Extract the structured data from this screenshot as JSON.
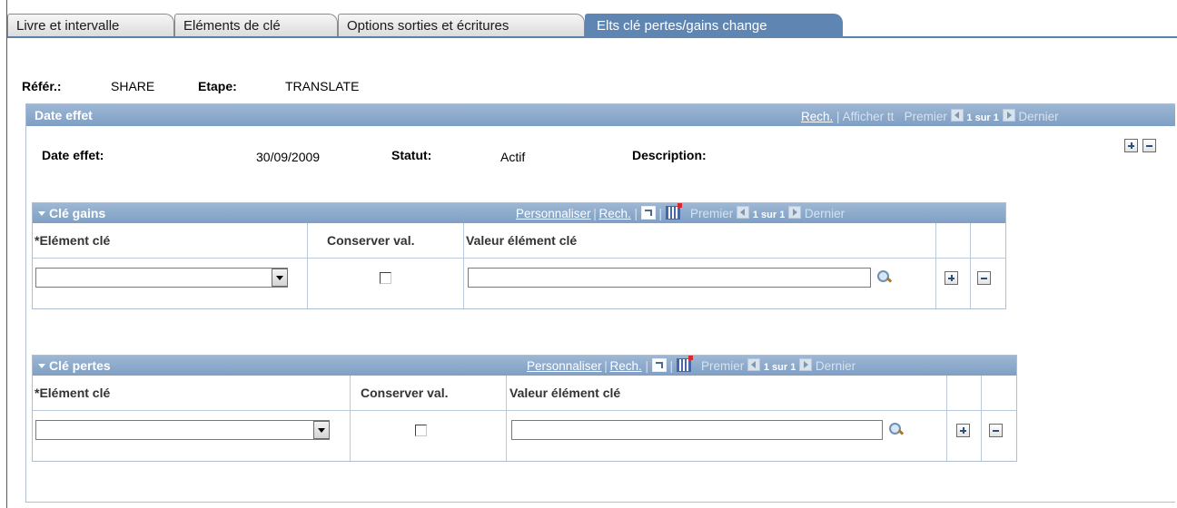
{
  "tabs": [
    {
      "label": "Livre et intervalle",
      "active": false
    },
    {
      "label": "Eléments de clé",
      "active": false
    },
    {
      "label": "Options sorties et écritures",
      "active": false
    },
    {
      "label": "Elts clé pertes/gains change",
      "active": true
    }
  ],
  "header": {
    "ref_label": "Référ.:",
    "ref_value": "SHARE",
    "step_label": "Etape:",
    "step_value": "TRANSLATE"
  },
  "date_effet": {
    "title": "Date effet",
    "nav": {
      "search": "Rech.",
      "show_all": "Afficher tt",
      "first": "Premier",
      "count": "1 sur 1",
      "last": "Dernier"
    },
    "fields": {
      "date_label": "Date effet:",
      "date_value": "30/09/2009",
      "status_label": "Statut:",
      "status_value": "Actif",
      "description_label": "Description:"
    }
  },
  "cle_gains": {
    "title": "Clé gains",
    "nav": {
      "customize": "Personnaliser",
      "search": "Rech.",
      "first": "Premier",
      "count": "1 sur 1",
      "last": "Dernier"
    },
    "columns": [
      "*Elément clé",
      "Conserver val.",
      "Valeur élément clé"
    ],
    "row": {
      "element": "",
      "keep": false,
      "value": ""
    }
  },
  "cle_pertes": {
    "title": "Clé pertes",
    "nav": {
      "customize": "Personnaliser",
      "search": "Rech.",
      "first": "Premier",
      "count": "1 sur 1",
      "last": "Dernier"
    },
    "columns": [
      "*Elément clé",
      "Conserver val.",
      "Valeur élément clé"
    ],
    "row": {
      "element": "",
      "keep": false,
      "value": ""
    }
  }
}
